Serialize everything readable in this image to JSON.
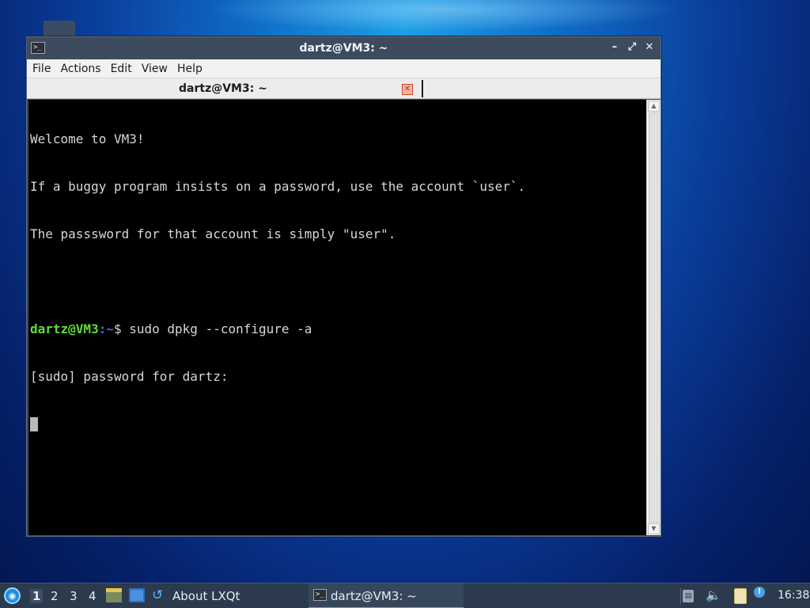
{
  "window": {
    "title": "dartz@VM3: ~",
    "controls": {
      "minimize": "–",
      "maximize": "⤢",
      "close": "✕"
    }
  },
  "menubar": [
    "File",
    "Actions",
    "Edit",
    "View",
    "Help"
  ],
  "tab": {
    "label": "dartz@VM3: ~"
  },
  "terminal": {
    "lines": [
      "Welcome to VM3!",
      "If a buggy program insists on a password, use the account `user`.",
      "The passsword for that account is simply \"user\".",
      ""
    ],
    "prompt_user": "dartz@VM3",
    "prompt_path": ":~",
    "prompt_symbol": "$ ",
    "command": "sudo dpkg --configure -a",
    "sudo_prompt": "[sudo] password for dartz:"
  },
  "taskbar": {
    "workspaces": [
      "1",
      "2",
      "3",
      "4"
    ],
    "active_workspace": "1",
    "about_label": "About LXQt",
    "task_label": "dartz@VM3: ~",
    "clock": "16:38"
  },
  "icons": {
    "app": "terminal-icon",
    "start": "lxqt-menu-icon",
    "file_manager": "file-manager-icon",
    "show_desktop": "show-desktop-icon",
    "about": "about-lxqt-icon",
    "keyboard": "keyboard-layout-icon",
    "volume": "volume-icon",
    "clipboard": "clipboard-icon",
    "notification": "notification-icon"
  },
  "colors": {
    "prompt_user": "#5fdc3a",
    "prompt_path": "#3b6ff2",
    "terminal_bg": "#000000",
    "terminal_fg": "#d7d7d7"
  }
}
